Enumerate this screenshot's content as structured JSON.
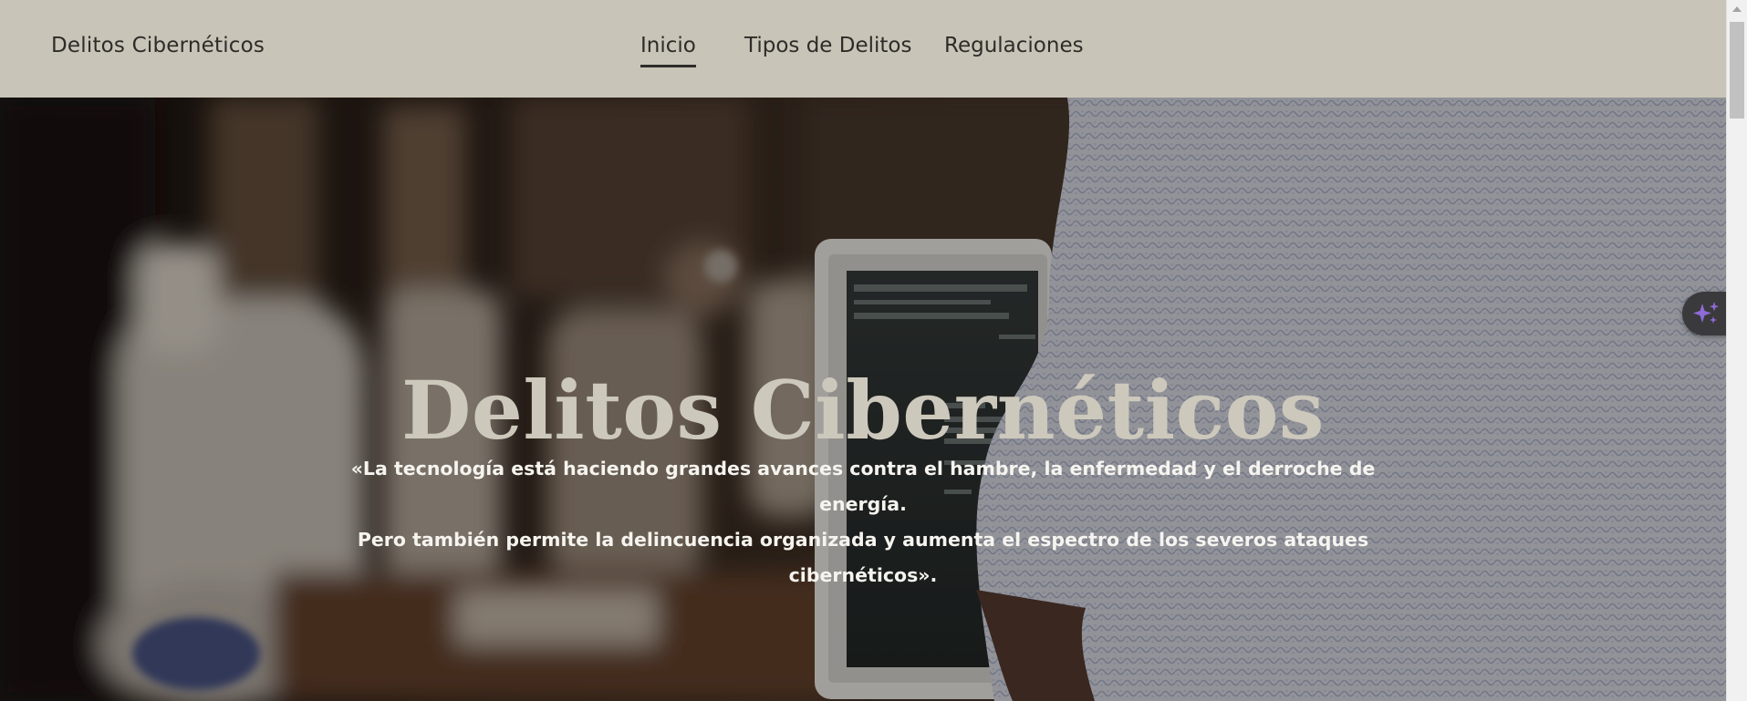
{
  "header": {
    "brand": "Delitos Cibernéticos",
    "nav": [
      {
        "label": "Inicio",
        "active": true
      },
      {
        "label": "Tipos de Delitos",
        "active": false
      },
      {
        "label": "Regulaciones",
        "active": false
      }
    ]
  },
  "hero": {
    "title": "Delitos Cibernéticos",
    "quote_lines": [
      "«La tecnología está haciendo grandes avances contra el hambre, la enfermedad y el derroche de energía.",
      "Pero también permite la delincuencia organizada y aumenta el espectro de los severos ataques",
      "cibernéticos»."
    ],
    "background": "photo of a person working on a laptop at a café table"
  },
  "assistant": {
    "icon": "sparkles-icon"
  },
  "colors": {
    "header_bg": "#c8c4b7",
    "text_dark": "#2e2c29",
    "title": "#cdc8bc",
    "quote": "#f6f4ef",
    "assistant_bg": "#3a3a3c",
    "sparkle": "#8e6bd8"
  }
}
